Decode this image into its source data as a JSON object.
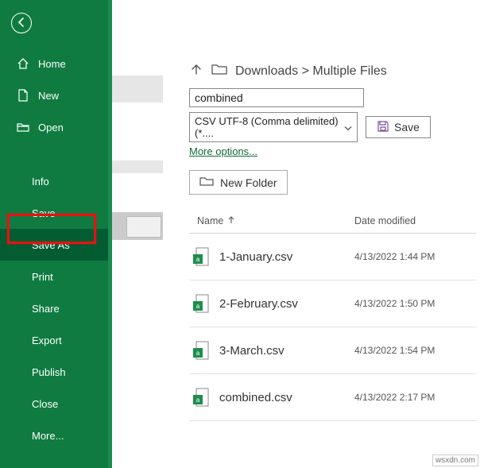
{
  "sidebar": {
    "home": "Home",
    "new": "New",
    "open": "Open",
    "info": "Info",
    "save": "Save",
    "saveas": "Save As",
    "print": "Print",
    "share": "Share",
    "export": "Export",
    "publish": "Publish",
    "close": "Close",
    "more": "More..."
  },
  "breadcrumb": {
    "folder1": "Downloads",
    "sep": ">",
    "folder2": "Multiple Files"
  },
  "filename": {
    "value": "combined"
  },
  "filetype": {
    "value": "CSV UTF-8 (Comma delimited) (*...."
  },
  "save_btn": "Save",
  "more_options": "More options...",
  "new_folder": "New Folder",
  "headers": {
    "name": "Name",
    "date": "Date modified"
  },
  "files": [
    {
      "name": "1-January.csv",
      "date": "4/13/2022 1:44 PM"
    },
    {
      "name": "2-February.csv",
      "date": "4/13/2022 1:50 PM"
    },
    {
      "name": "3-March.csv",
      "date": "4/13/2022 1:54 PM"
    },
    {
      "name": "combined.csv",
      "date": "4/13/2022 2:17 PM"
    }
  ],
  "watermark": "wsxdn.com"
}
